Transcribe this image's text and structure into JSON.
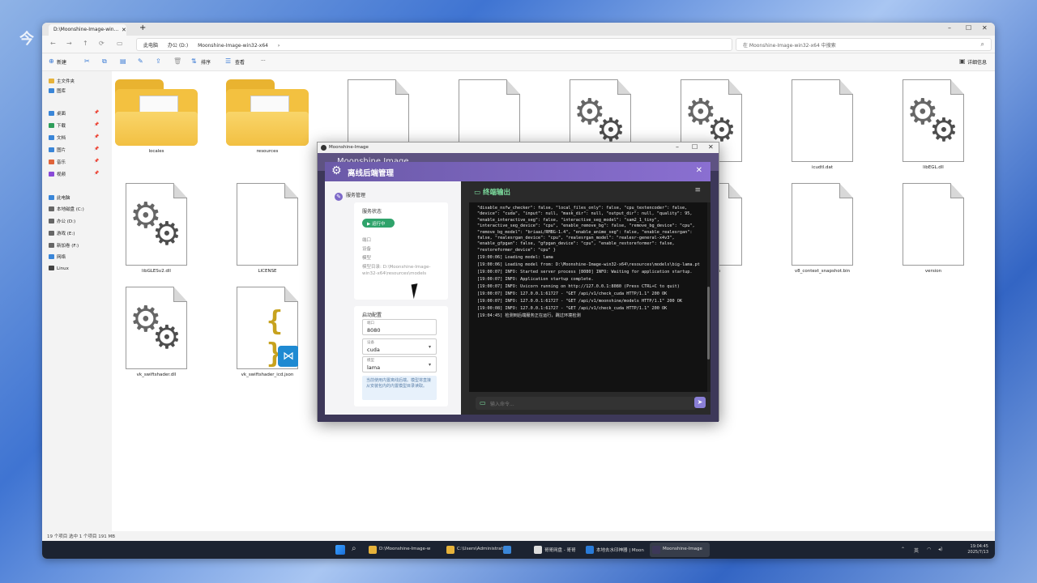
{
  "explorer": {
    "tab_title": "D:\\Moonshine-Image-win...",
    "address": [
      "此电脑",
      "办公 (D:)",
      "Moonshine-Image-win32-x64",
      "›"
    ],
    "search_placeholder": "在 Moonshine-Image-win32-x64 中搜索",
    "commands": {
      "new": "新建",
      "sort": "排序",
      "view": "查看",
      "more": "···",
      "details": "详细信息"
    },
    "nav": [
      {
        "label": "主文件夹",
        "color": "#e6b23a"
      },
      {
        "label": "图库",
        "color": "#3a86d8"
      },
      {
        "label": "桌面",
        "color": "#3a86d8",
        "pin": true
      },
      {
        "label": "下载",
        "color": "#2e9e5b",
        "pin": true
      },
      {
        "label": "文档",
        "color": "#3a86d8",
        "pin": true
      },
      {
        "label": "图片",
        "color": "#3a86d8",
        "pin": true
      },
      {
        "label": "音乐",
        "color": "#e0643a",
        "pin": true
      },
      {
        "label": "视频",
        "color": "#8a4ad8",
        "pin": true
      },
      {
        "label": "此电脑",
        "color": "#3a86d8"
      },
      {
        "label": "本地磁盘 (C:)",
        "color": "#666666"
      },
      {
        "label": "办公 (D:)",
        "color": "#666666"
      },
      {
        "label": "游戏 (E:)",
        "color": "#666666"
      },
      {
        "label": "新加卷 (F:)",
        "color": "#666666"
      },
      {
        "label": "网络",
        "color": "#3a86d8"
      },
      {
        "label": "Linux",
        "color": "#444444"
      }
    ],
    "files": [
      {
        "name": "locales",
        "type": "folder"
      },
      {
        "name": "resources",
        "type": "folder"
      },
      {
        "name": "",
        "type": "doc"
      },
      {
        "name": "",
        "type": "doc"
      },
      {
        "name": "",
        "type": "gear"
      },
      {
        "name": "",
        "type": "gear"
      },
      {
        "name": "icudtl.dat",
        "type": "doc"
      },
      {
        "name": "libEGL.dll",
        "type": "gear"
      },
      {
        "name": "libGLESv2.dll",
        "type": "gear"
      },
      {
        "name": "LICENSE",
        "type": "doc"
      },
      {
        "name": "",
        "type": "doc"
      },
      {
        "name": "",
        "type": "doc"
      },
      {
        "name": "",
        "type": "doc"
      },
      {
        "name": "...ob.bin",
        "type": "doc"
      },
      {
        "name": "v8_context_snapshot.bin",
        "type": "doc"
      },
      {
        "name": "version",
        "type": "doc"
      },
      {
        "name": "vk_swiftshader.dll",
        "type": "gear"
      },
      {
        "name": "vk_swiftshader_icd.json",
        "type": "json"
      }
    ],
    "status": "19 个项目    选中 1 个项目  191 MB"
  },
  "app": {
    "window_title": "Moonshine-Image",
    "header_title": "Moonshine Image"
  },
  "modal": {
    "title": "离线后端管理",
    "left": {
      "section": "服务管理",
      "service_card_title": "服务状态",
      "running_label": "▶ 运行中",
      "kv": [
        "端口",
        "设备",
        "模型"
      ],
      "model_path": "模型目录: D:\\Moonshine-Image-win32-x64\\resources\\models",
      "start_card_title": "启动配置",
      "port_label": "端口",
      "port_value": "8080",
      "device_label": "设备",
      "device_value": "cuda",
      "model_label": "模型",
      "model_value": "lama",
      "note": "当前使用内置离线后端。模型将直接从安装包内的内置模型目录读取。"
    },
    "terminal": {
      "title": "终端输出",
      "input_placeholder": "输入命令...",
      "lines": [
        "\"disable_nsfw_checker\": false, \"local_files_only\": false, \"cpu_textencoder\": false, \"device\": \"cuda\", \"input\": null, \"mask_dir\": null, \"output_dir\": null, \"quality\": 95, \"enable_interactive_seg\": false, \"interactive_seg_model\": \"sam2_1_tiny\", \"interactive_seg_device\": \"cpu\", \"enable_remove_bg\": false, \"remove_bg_device\": \"cpu\", \"remove_bg_model\": \"briaai/RMBG-1.4\", \"enable_anime_seg\": false, \"enable_realesrgan\": false, \"realesrgan_device\": \"cpu\", \"realesrgan_model\": \"realesr-general-x4v3\", \"enable_gfpgan\": false, \"gfpgan_device\": \"cpu\", \"enable_restoreformer\": false, \"restoreformer_device\": \"cpu\" }",
        "[19:00:06] Loading model: lama",
        "[19:00:06] Loading model from: D:\\Moonshine-Image-win32-x64\\resources\\models\\big-lama.pt",
        "[19:00:07] INFO: Started server process [8080] INFO: Waiting for application startup.",
        "[19:00:07] INFO: Application startup complete.",
        "[19:00:07] INFO: Uvicorn running on http://127.0.0.1:8080 (Press CTRL+C to quit)",
        "[19:00:07] INFO: 127.0.0.1:61727 - \"GET /api/v1/check_cuda HTTP/1.1\" 200 OK",
        "[19:00:07] INFO: 127.0.0.1:61727 - \"GET /api/v1/moonshine/models HTTP/1.1\" 200 OK",
        "[19:00:08] INFO: 127.0.0.1:61727 - \"GET /api/v1/check_cuda HTTP/1.1\" 200 OK",
        "[19:04:45] 检测到后端服务正在运行，跳过环境检测"
      ]
    }
  },
  "taskbar": {
    "items": [
      {
        "label": "D:\\Moonshine-Image-w",
        "color": "#e6b23a"
      },
      {
        "label": "C:\\Users\\Administrator\\",
        "color": "#e6b23a"
      },
      {
        "label": "",
        "color": "#3a86d8"
      },
      {
        "label": "哥哥网盘 - 哥哥",
        "color": "#dddddd"
      },
      {
        "label": "本地去水印神器 | Moon",
        "color": "#2a7bd8"
      },
      {
        "label": "Moonshine-Image",
        "color": "#3d3859"
      }
    ],
    "tray": "英",
    "time": "19:04:45",
    "date": "2025/7/13"
  },
  "watermark": "今"
}
